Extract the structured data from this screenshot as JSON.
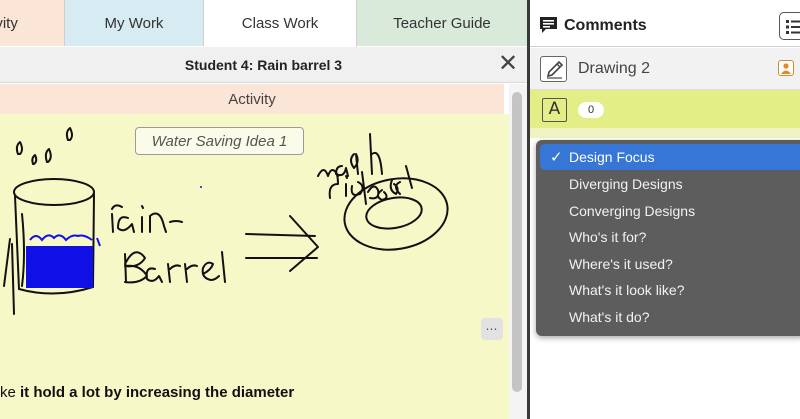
{
  "tabs": [
    "ivity",
    "My Work",
    "Class Work",
    "Teacher Guide"
  ],
  "document": {
    "title": "Student 4: Rain barrel 3",
    "close_glyph": "✕",
    "section_label": "Activity",
    "tile_label": "Water Saving Idea 1",
    "more_glyph": "⋯",
    "caption_prefix": "ke ",
    "caption_bold": "it hold a lot by increasing the diameter",
    "sketch_icons": [
      "raindrop-drawing",
      "barrel-drawing",
      "arrow-drawing",
      "dish-drawing"
    ]
  },
  "comments": {
    "title": "Comments",
    "doc_name": "Drawing 2",
    "tag_count": "0",
    "tag_glyph": "A",
    "options": [
      "Design Focus",
      "Diverging Designs",
      "Converging Designs",
      "Who's it for?",
      "Where's it used?",
      "What's it look like?",
      "What's it do?"
    ],
    "selected_index": 0
  },
  "colors": {
    "activity_tab": "#fbe5d6",
    "mywork_tab": "#d6ebf2",
    "guide_tab": "#d9eadb",
    "canvas": "#f7f8c8",
    "tag_row": "#e4ee86",
    "dropdown_bg": "#5e5d5d",
    "selected": "#3576d6",
    "ink_blue": "#1010e6"
  }
}
